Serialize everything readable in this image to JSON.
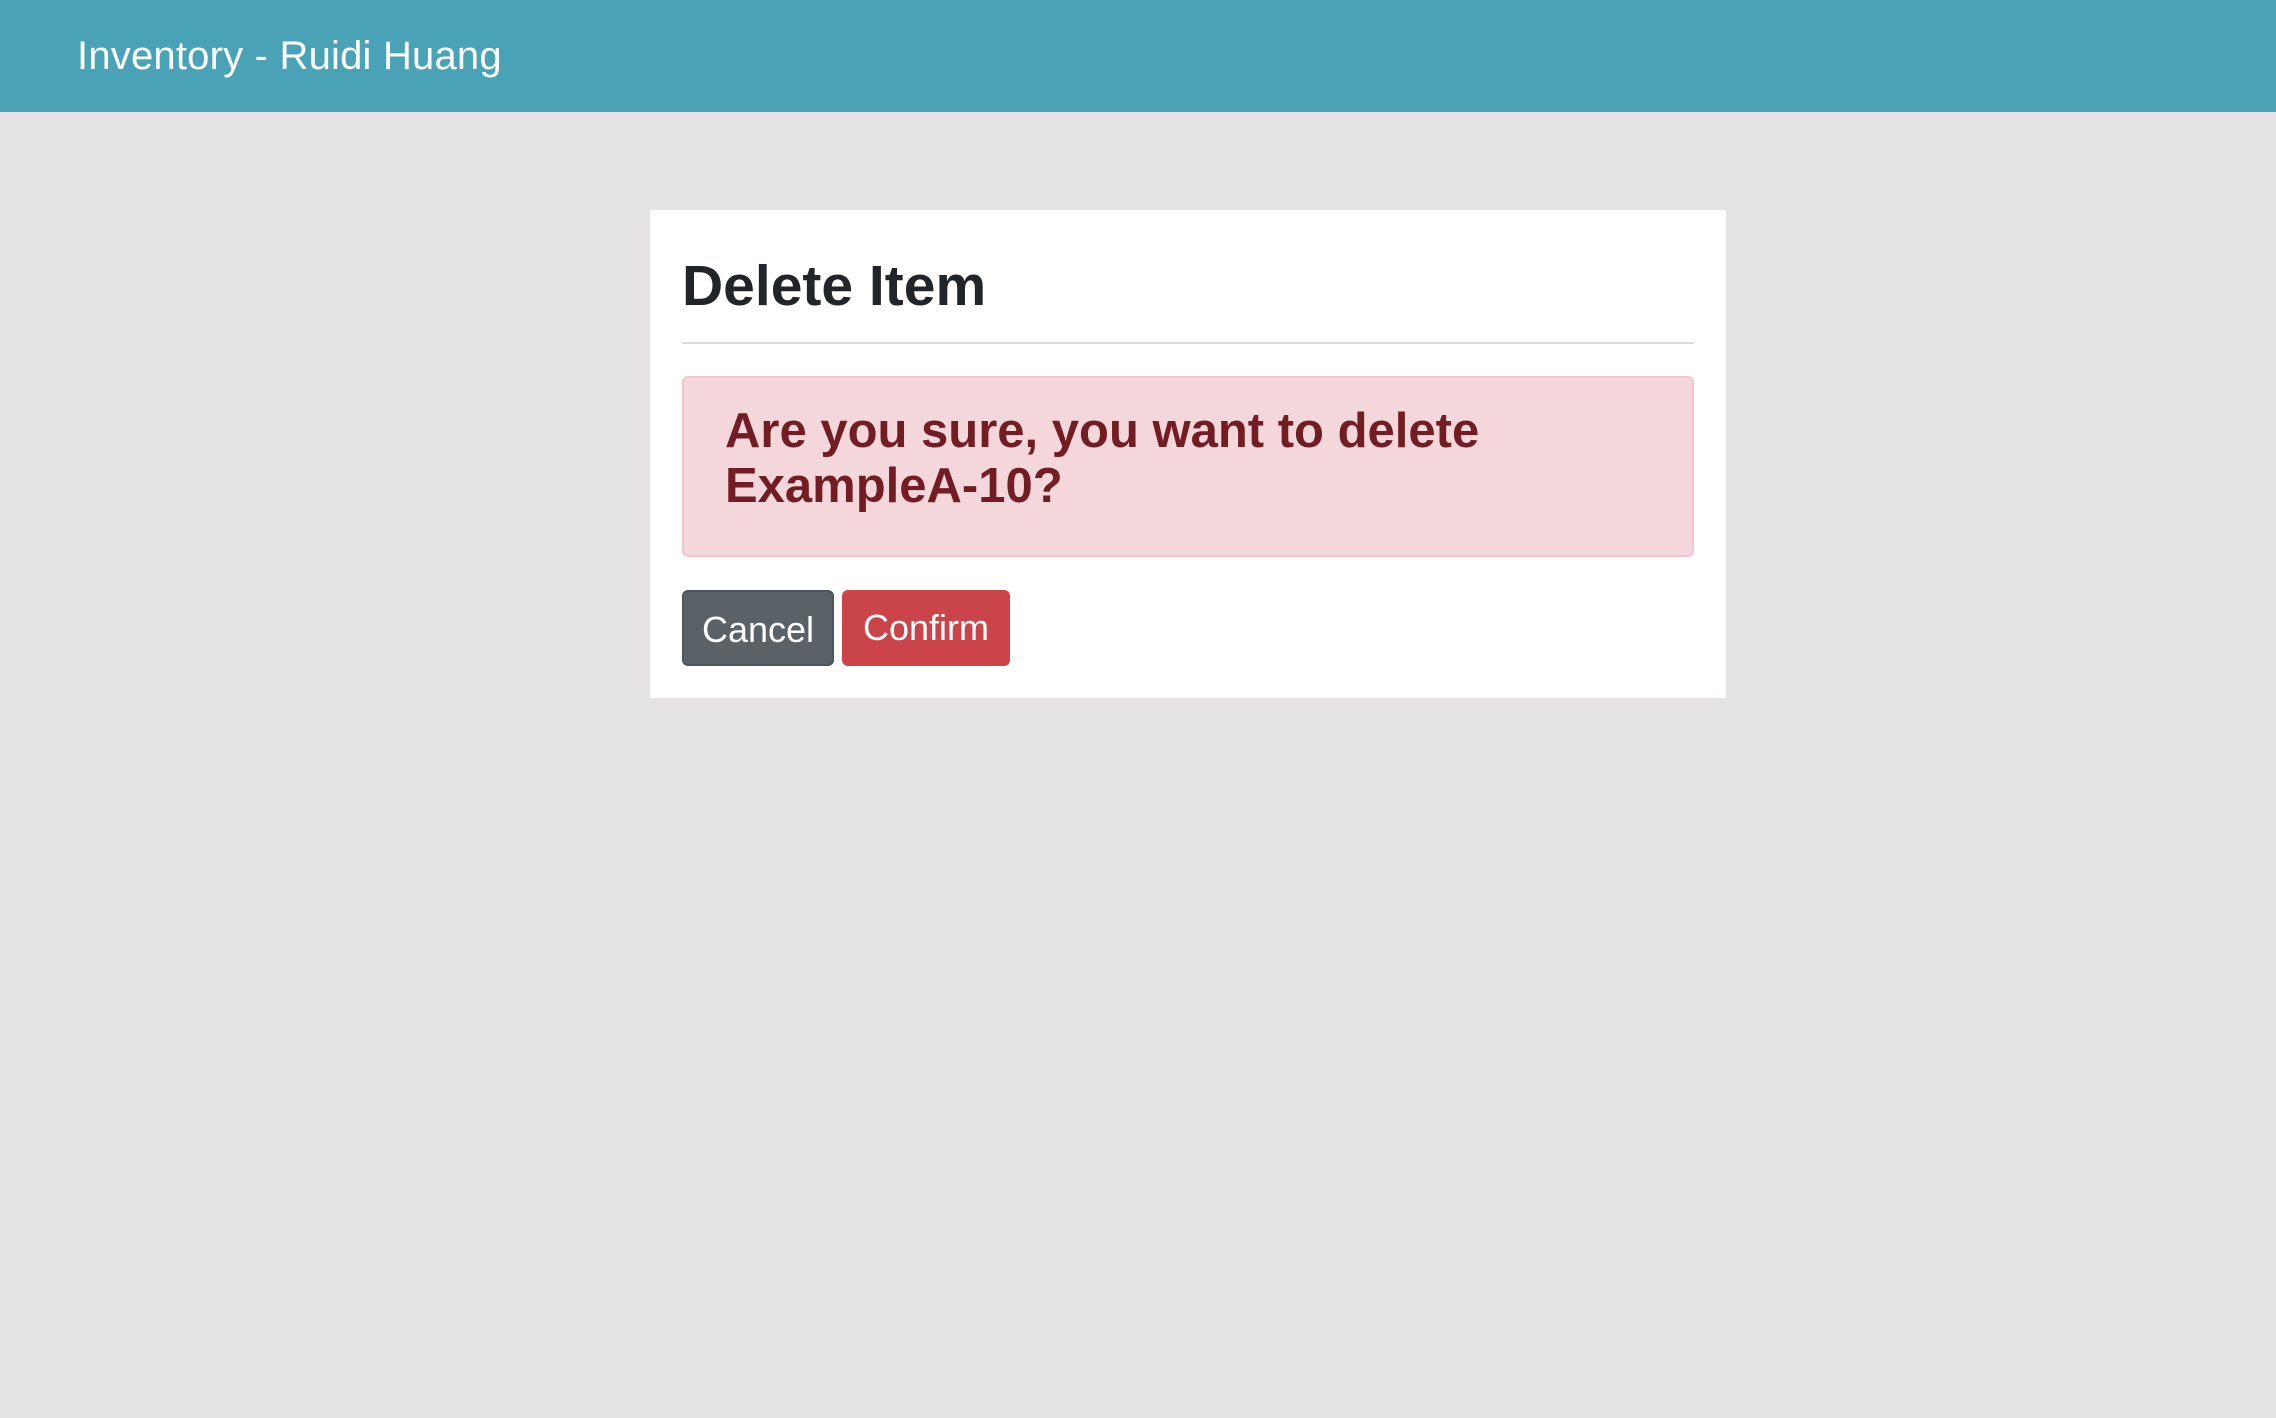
{
  "navbar": {
    "brand": "Inventory - Ruidi Huang"
  },
  "card": {
    "title": "Delete Item",
    "alert_message": "Are you sure, you want to delete ExampleA-10?",
    "buttons": {
      "cancel_label": "Cancel",
      "confirm_label": "Confirm"
    }
  },
  "colors": {
    "navbar_bg": "#4aa2b6",
    "page_bg": "#e5e3e4",
    "alert_bg": "#f3d7da",
    "alert_text": "#721c24",
    "cancel_bg": "#5a6268",
    "confirm_bg": "#cb444a"
  }
}
